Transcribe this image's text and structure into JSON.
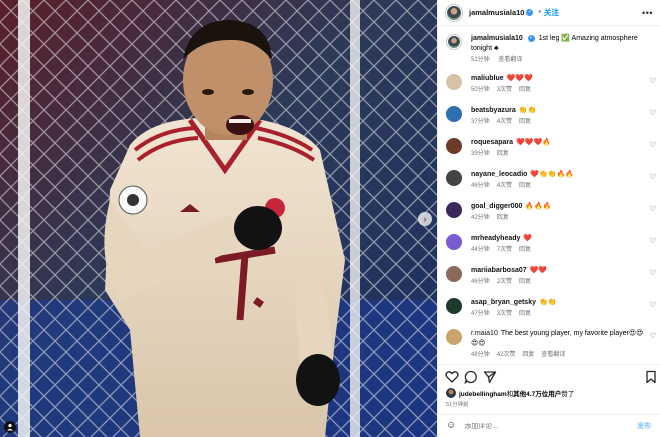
{
  "post": {
    "author": "jamalmusiala10",
    "follow_label": "关注",
    "dot": "•",
    "caption_user": "jamalmusiala10",
    "caption_text": "1st leg ✅ Amazing atmosphere tonight",
    "caption_emoji": "♣",
    "caption_time": "51分钟",
    "see_translation": "查看翻译"
  },
  "comments": [
    {
      "user": "maliublue",
      "text": "❤️❤️❤️",
      "time": "50分钟",
      "likes": "3次赞",
      "reply": "回复",
      "avatar_color": "#d6c3a5"
    },
    {
      "user": "beatsbyazura",
      "text": "👏👏",
      "time": "37分钟",
      "likes": "4次赞",
      "reply": "回复",
      "avatar_color": "#2f6fb0"
    },
    {
      "user": "roquesapara",
      "text": "❤️❤️❤️🔥",
      "time": "39分钟",
      "likes": "",
      "reply": "回复",
      "avatar_color": "#6b3b2a"
    },
    {
      "user": "nayane_leocadio",
      "text": "❤️👏👏🔥🔥",
      "time": "46分钟",
      "likes": "4次赞",
      "reply": "回复",
      "avatar_color": "#444444"
    },
    {
      "user": "goal_digger000",
      "text": "🔥🔥🔥",
      "time": "42分钟",
      "likes": "",
      "reply": "回复",
      "avatar_color": "#3a2a5c"
    },
    {
      "user": "mrheadyheady",
      "text": "❤️",
      "time": "44分钟",
      "likes": "7次赞",
      "reply": "回复",
      "avatar_color": "#7a5bd1"
    },
    {
      "user": "mariiabarbosa07",
      "text": "❤️❤️",
      "time": "46分钟",
      "likes": "2次赞",
      "reply": "回复",
      "avatar_color": "#8a6a5c"
    },
    {
      "user": "asap_bryan_getsky",
      "text": "👏👏",
      "time": "47分钟",
      "likes": "3次赞",
      "reply": "回复",
      "avatar_color": "#1f3a2c"
    },
    {
      "user": "r.maia10",
      "text": "The best young player, my favorite player😍😍 😍😍",
      "time": "48分钟",
      "likes": "42次赞",
      "reply": "回复",
      "translate": "查看翻译",
      "avatar_color": "#c9a46b"
    }
  ],
  "likes": {
    "liker": "judebellingham",
    "and_text": "和",
    "others": "其他4.7万位用户",
    "suffix": "赞了"
  },
  "post_time": "51分钟前",
  "add_comment": {
    "placeholder": "添加评论...",
    "post_label": "发布"
  },
  "icons": {
    "heart": "heart-icon",
    "comment": "comment-icon",
    "share": "share-icon",
    "save": "bookmark-icon",
    "more": "more-icon",
    "emoji": "emoji-icon",
    "next": "chevron-right-icon"
  },
  "colors": {
    "accent": "#0095f6",
    "verified": "#3797f0",
    "muted": "#737373"
  }
}
